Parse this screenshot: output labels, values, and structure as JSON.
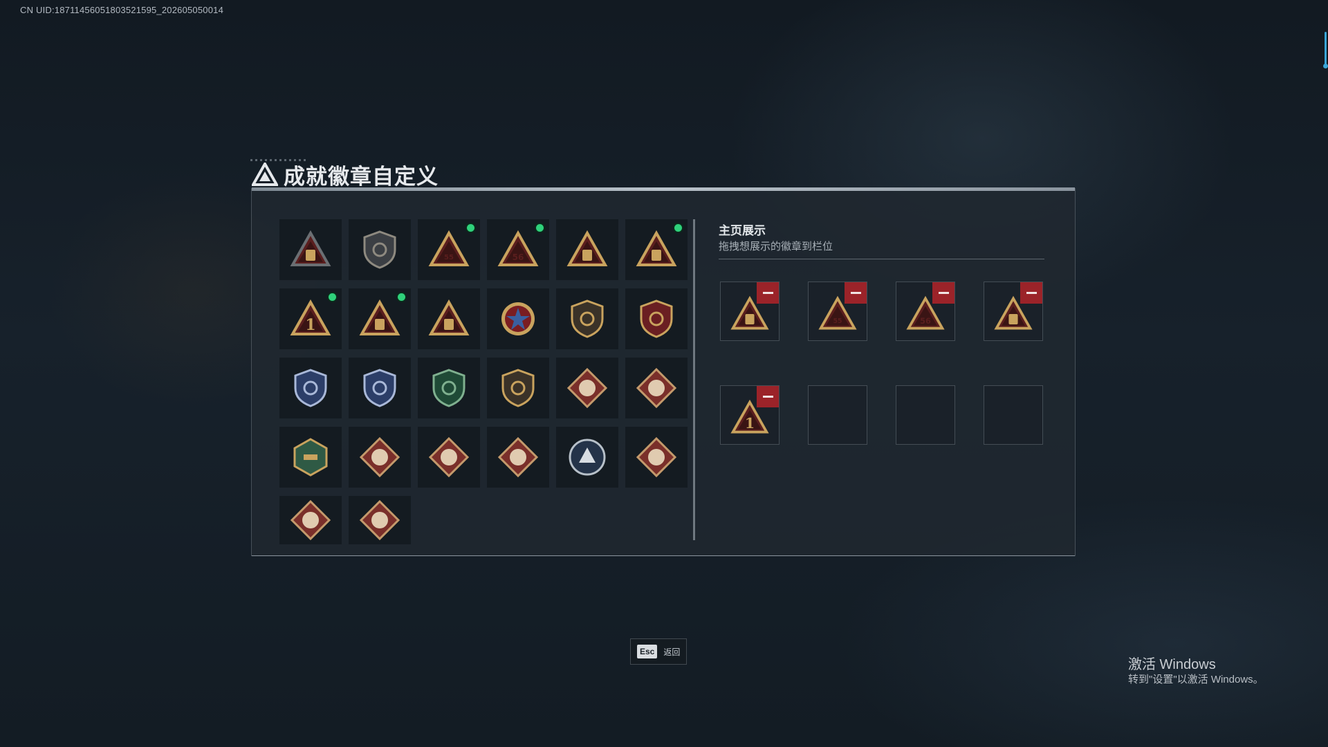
{
  "uid_label": "CN UID:18711456051803521595_202605050014",
  "title": "成就徽章自定义",
  "showcase": {
    "title": "主页展示",
    "subtitle": "拖拽想展示的徽章到栏位"
  },
  "footer": {
    "esc_key": "Esc",
    "esc_label": "返回"
  },
  "watermark": {
    "title": "激活 Windows",
    "subtitle": "转到\"设置\"以激活 Windows。"
  },
  "badges": [
    {
      "icon": "gray-shield-triangle-icon",
      "new": false
    },
    {
      "icon": "helicopter-shield-icon",
      "new": false
    },
    {
      "icon": "gold-triangle-sack-55-icon",
      "new": true
    },
    {
      "icon": "gold-triangle-vest-56-icon",
      "new": true
    },
    {
      "icon": "gold-triangle-frame-icon",
      "new": false
    },
    {
      "icon": "gold-triangle-hat-icon",
      "new": true
    },
    {
      "icon": "gold-triangle-number-1-icon",
      "new": true
    },
    {
      "icon": "gold-triangle-bottle-icon",
      "new": true
    },
    {
      "icon": "gold-triangle-figure-icon",
      "new": false
    },
    {
      "icon": "red-star-medal-icon",
      "new": false
    },
    {
      "icon": "gold-shield-wing-icon",
      "new": false
    },
    {
      "icon": "red-shield-eagle-icon",
      "new": false
    },
    {
      "icon": "blue-wolf-shield-icon",
      "new": false
    },
    {
      "icon": "blue-crosshair-shield-icon",
      "new": false
    },
    {
      "icon": "green-crosshair-shield-icon",
      "new": false
    },
    {
      "icon": "gold-crosshair-shield-icon",
      "new": false
    },
    {
      "icon": "gold-wreath-crosshair-icon",
      "new": false
    },
    {
      "icon": "brown-diamond-tiger-icon",
      "new": false
    },
    {
      "icon": "green-hexagon-gun-icon",
      "new": false
    },
    {
      "icon": "brown-diamond-dragon-icon",
      "new": false
    },
    {
      "icon": "brown-diamond-dragon-alt-icon",
      "new": false
    },
    {
      "icon": "brown-diamond-runner-icon",
      "new": false
    },
    {
      "icon": "blue-circle-wolf-icon",
      "new": false
    },
    {
      "icon": "brown-diamond-tiger-alt-icon",
      "new": false
    },
    {
      "icon": "brown-diamond-bear-icon",
      "new": false
    },
    {
      "icon": "brown-diamond-wheel-icon",
      "new": false
    }
  ],
  "slots": [
    {
      "icon": "gold-triangle-bottle-icon",
      "filled": true
    },
    {
      "icon": "gold-triangle-sack-55-icon",
      "filled": true
    },
    {
      "icon": "gold-triangle-vest-56-icon",
      "filled": true
    },
    {
      "icon": "gold-triangle-hat-icon",
      "filled": true
    },
    {
      "icon": "gold-triangle-number-1-icon",
      "filled": true
    },
    {
      "icon": "",
      "filled": false
    },
    {
      "icon": "",
      "filled": false
    },
    {
      "icon": "",
      "filled": false
    }
  ],
  "colors": {
    "accent_green": "#2fd17b",
    "remove_red": "#9b2329",
    "gold": "#c9a35e",
    "maroon": "#5a1e1e"
  }
}
